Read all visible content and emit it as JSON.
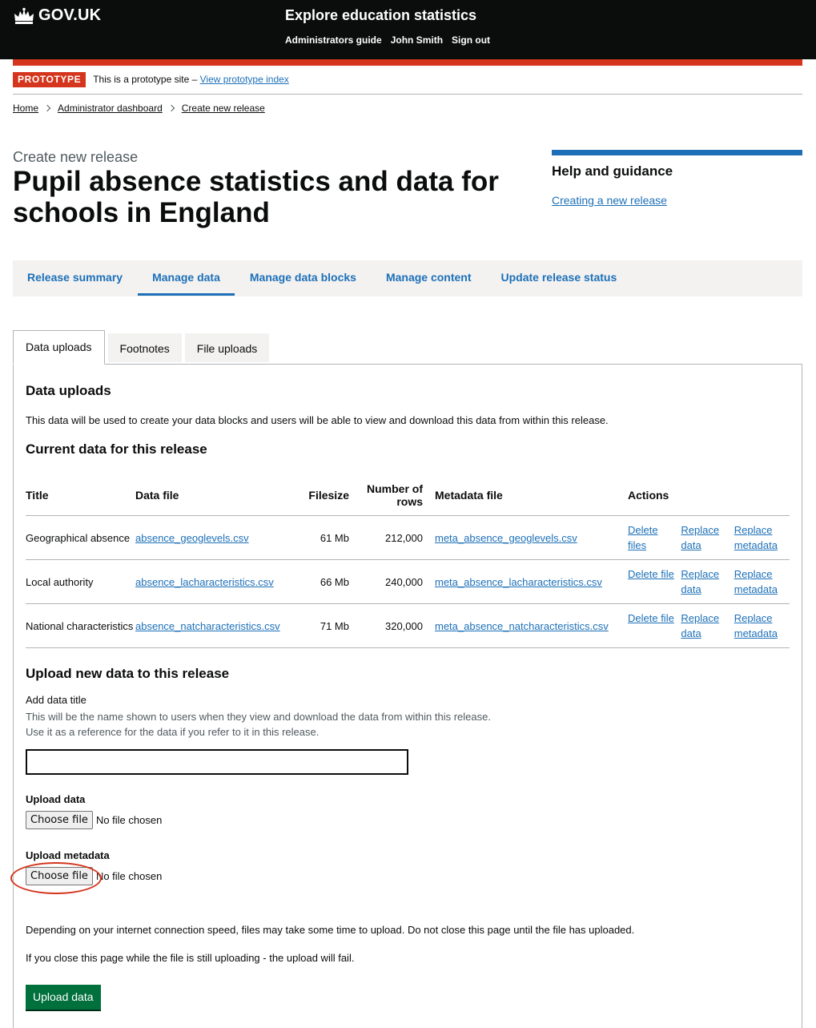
{
  "header": {
    "logo_text": "GOV.UK",
    "service_name": "Explore education statistics",
    "nav": [
      "Administrators guide",
      "John Smith",
      "Sign out"
    ]
  },
  "phase": {
    "tag": "PROTOTYPE",
    "text": "This is a prototype site –",
    "link": "View prototype index"
  },
  "breadcrumbs": [
    "Home",
    "Administrator dashboard",
    "Create new release"
  ],
  "caption": "Create new release",
  "title": "Pupil absence statistics and data for schools in England",
  "help": {
    "title": "Help and guidance",
    "link": "Creating a new release"
  },
  "nav_tabs": [
    "Release summary",
    "Manage data",
    "Manage data blocks",
    "Manage content",
    "Update release status"
  ],
  "active_nav_tab": "Manage data",
  "tabs": [
    "Data uploads",
    "Footnotes",
    "File uploads"
  ],
  "active_tab": "Data uploads",
  "section": {
    "heading": "Data uploads",
    "lead": "This data will be used to create your data blocks and users will be able to view and download this data from within this release.",
    "current_heading": "Current data for this release"
  },
  "table": {
    "headers": [
      "Title",
      "Data file",
      "Filesize",
      "Number of rows",
      "Metadata file",
      "Actions"
    ],
    "rows": [
      {
        "title": "Geographical absence",
        "data_file": "absence_geoglevels.csv",
        "filesize": "61 Mb",
        "rows": "212,000",
        "metadata_file": "meta_absence_geoglevels.csv",
        "actions": [
          "Delete files",
          "Replace data",
          "Replace metadata"
        ]
      },
      {
        "title": "Local authority",
        "data_file": "absence_lacharacteristics.csv",
        "filesize": "66 Mb",
        "rows": "240,000",
        "metadata_file": "meta_absence_lacharacteristics.csv",
        "actions": [
          "Delete file",
          "Replace data",
          "Replace metadata"
        ]
      },
      {
        "title": "National characteristics",
        "data_file": "absence_natcharacteristics.csv",
        "filesize": "71 Mb",
        "rows": "320,000",
        "metadata_file": "meta_absence_natcharacteristics.csv",
        "actions": [
          "Delete file",
          "Replace data",
          "Replace metadata"
        ]
      }
    ]
  },
  "upload": {
    "heading": "Upload new data to this release",
    "title_label": "Add data title",
    "title_hint_1": "This will be the name shown to users when they view and download the data from within this release.",
    "title_hint_2": "Use it as a reference for the data if you refer to it in this release.",
    "title_value": "",
    "data_label": "Upload data",
    "metadata_label": "Upload metadata",
    "choose_file": "Choose file",
    "no_file": "No file chosen",
    "note_1": "Depending on your internet connection speed, files may take some time to upload. Do not close this page until the file has uploaded.",
    "note_2": "If you close this page while the file is still uploading - the upload will fail.",
    "submit": "Upload data"
  },
  "colors": {
    "header_bg": "#0b0c0c",
    "accent_red": "#d4351c",
    "link_blue": "#1d70b8",
    "button_green": "#00703c"
  }
}
